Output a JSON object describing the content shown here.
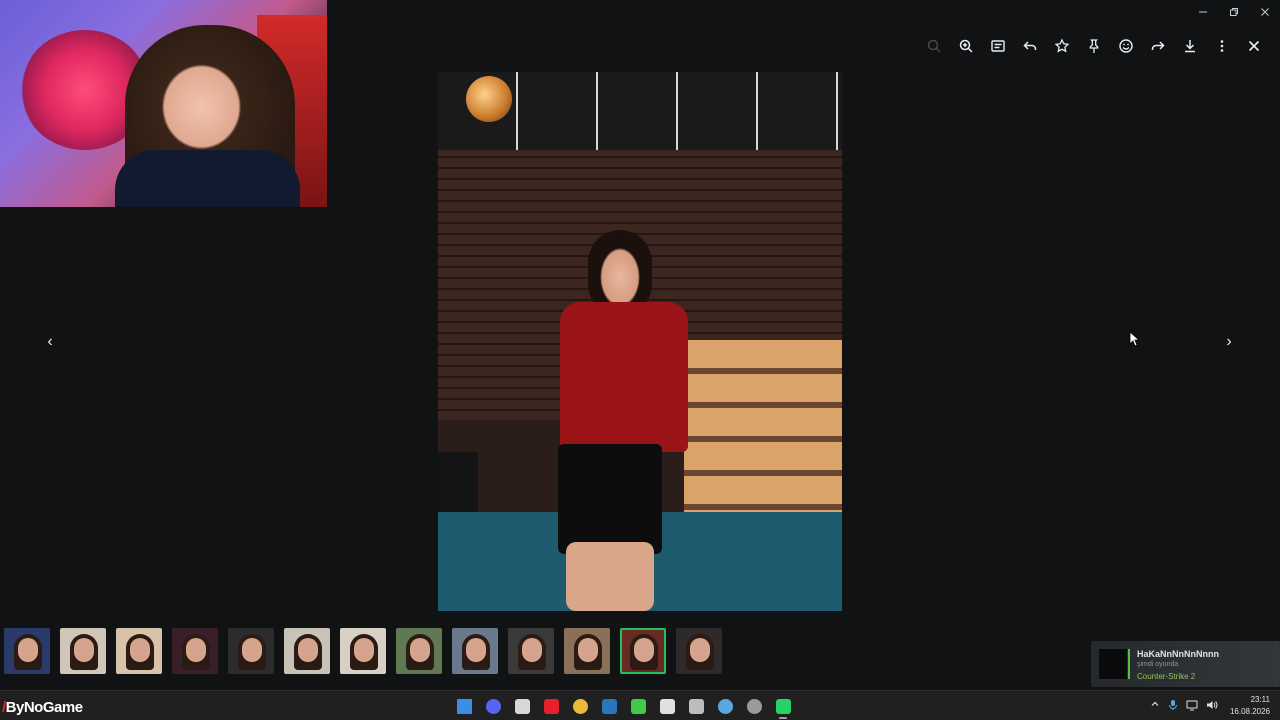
{
  "window": {
    "controls": [
      "minimize",
      "restore",
      "close"
    ]
  },
  "toolbar": {
    "buttons": [
      {
        "icon": "search-icon",
        "enabled": false
      },
      {
        "icon": "zoom-in-icon",
        "enabled": true
      },
      {
        "icon": "caption-icon",
        "enabled": true
      },
      {
        "icon": "reply-icon",
        "enabled": true
      },
      {
        "icon": "star-icon",
        "enabled": true
      },
      {
        "icon": "pin-icon",
        "enabled": true
      },
      {
        "icon": "emoji-icon",
        "enabled": true
      },
      {
        "icon": "forward-icon",
        "enabled": true
      },
      {
        "icon": "download-icon",
        "enabled": true
      },
      {
        "icon": "more-icon",
        "enabled": true
      },
      {
        "icon": "close-icon",
        "enabled": true
      }
    ]
  },
  "navigation": {
    "prev": "‹",
    "next": "›"
  },
  "thumbnails": {
    "count": 13,
    "active_index": 11
  },
  "notification": {
    "name": "HaKaNnNnNnNnnn",
    "status": "şimdi oyunda",
    "game": "Counter-Strike 2"
  },
  "taskbar": {
    "brand_slash": "/",
    "brand_text": "ByNoGame",
    "apps": [
      {
        "icon": "windows-start-icon",
        "color": "#3a8ee6"
      },
      {
        "icon": "discord-icon",
        "color": "#5865f2"
      },
      {
        "icon": "store-icon",
        "color": "#d8d8d8"
      },
      {
        "icon": "app-red-icon",
        "color": "#e8202b"
      },
      {
        "icon": "chrome-icon",
        "color": "#e8b93a"
      },
      {
        "icon": "steam-icon",
        "color": "#2a75bb"
      },
      {
        "icon": "play-icon",
        "color": "#41c94a"
      },
      {
        "icon": "tool-icon",
        "color": "#e0e0e0"
      },
      {
        "icon": "epic-icon",
        "color": "#bdbdbd"
      },
      {
        "icon": "network-icon",
        "color": "#5aa7e0"
      },
      {
        "icon": "settings-icon",
        "color": "#9a9a9a"
      },
      {
        "icon": "whatsapp-icon",
        "color": "#25d366"
      }
    ],
    "time": "23:11",
    "date": "16.08.2026"
  },
  "colors": {
    "accent": "#21c063",
    "background": "#111213"
  }
}
